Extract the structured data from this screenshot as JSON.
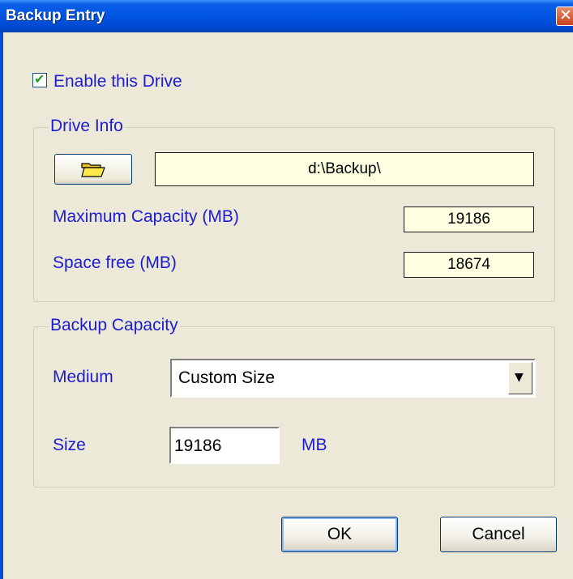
{
  "window": {
    "title": "Backup Entry",
    "close_label": "✕"
  },
  "enable": {
    "label": "Enable this Drive",
    "checked": true
  },
  "drive_info": {
    "legend": "Drive Info",
    "path": "d:\\Backup\\",
    "max_capacity_label": "Maximum Capacity (MB)",
    "max_capacity_value": "19186",
    "space_free_label": "Space free (MB)",
    "space_free_value": "18674"
  },
  "backup_capacity": {
    "legend": "Backup Capacity",
    "medium_label": "Medium",
    "medium_value": "Custom Size",
    "size_label": "Size",
    "size_value": "19186",
    "size_unit": "MB"
  },
  "buttons": {
    "ok": "OK",
    "cancel": "Cancel"
  },
  "icons": {
    "folder": "folder-icon",
    "dropdown": "chevron-down-icon",
    "check": "check-icon"
  },
  "colors": {
    "label_blue": "#1c1cd2",
    "title_blue": "#0054e3",
    "field_yellow": "#ffffe1",
    "dialog_bg": "#ece9d8"
  }
}
